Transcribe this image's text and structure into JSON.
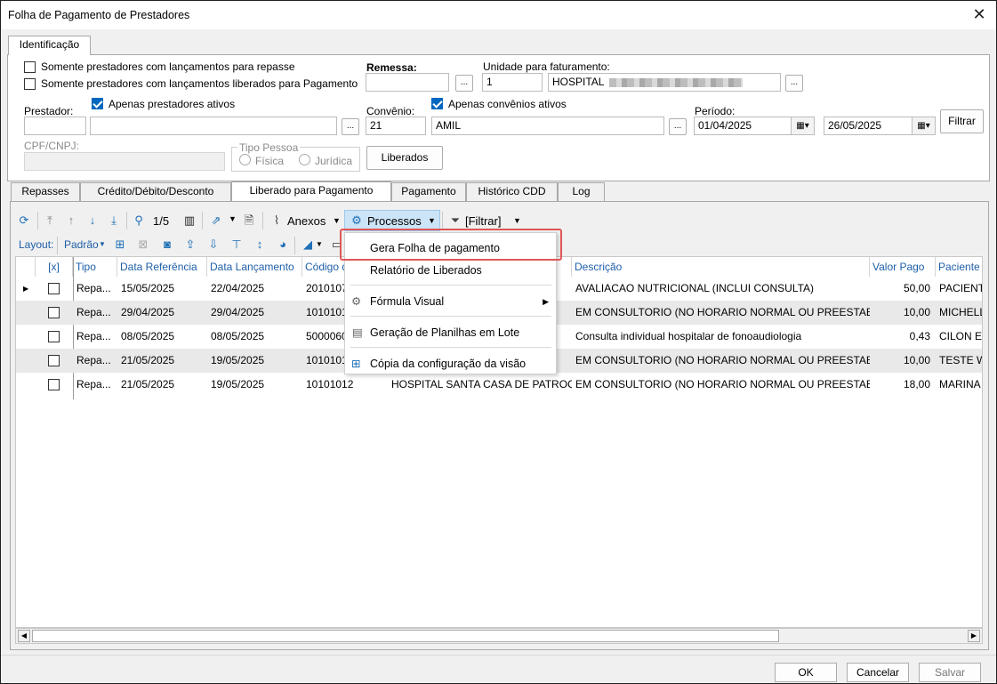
{
  "window": {
    "title": "Folha de Pagamento de Prestadores"
  },
  "top_tab": {
    "label": "Identificação"
  },
  "filters": {
    "chk_repasse": "Somente prestadores com lançamentos para repasse",
    "chk_liberados": "Somente prestadores com lançamentos liberados para Pagamento",
    "remessa_label": "Remessa:",
    "unidade_label": "Unidade para faturamento:",
    "unidade_code": "1",
    "unidade_name": "HOSPITAL",
    "prestador_label": "Prestador:",
    "chk_prestadores_ativos": "Apenas prestadores ativos",
    "convenio_label": "Convênio:",
    "convenio_code": "21",
    "convenio_name": "AMIL",
    "chk_convenios_ativos": "Apenas convênios ativos",
    "periodo_label": "Período:",
    "date_from": "01/04/2025",
    "date_to": "26/05/2025",
    "filtrar": "Filtrar",
    "cpf_label": "CPF/CNPJ:",
    "tipo_pessoa_label": "Tipo Pessoa",
    "fisica": "Física",
    "juridica": "Jurídica",
    "liberados_btn": "Liberados",
    "dots": "..."
  },
  "sub_tabs": [
    "Repasses",
    "Crédito/Débito/Desconto",
    "Liberado para Pagamento",
    "Pagamento",
    "Histórico CDD",
    "Log"
  ],
  "toolbar": {
    "page": "1/5",
    "anexos": "Anexos",
    "processos": "Processos",
    "filtrar": "[Filtrar]",
    "layout_label": "Layout:",
    "layout_value": "Padrão"
  },
  "grid": {
    "headers": [
      "[x]",
      "Tipo",
      "Data Referência",
      "Data Lançamento",
      "Código do",
      "",
      "Descrição",
      "Valor Pago",
      "Paciente"
    ],
    "rows": [
      {
        "tipo": "Repa...",
        "ref": "15/05/2025",
        "lanc": "22/04/2025",
        "codigo": "2010107",
        "origem": "",
        "descricao": "AVALIACAO NUTRICIONAL (INCLUI CONSULTA)",
        "valor": "50,00",
        "paciente": "PACIENTE"
      },
      {
        "tipo": "Repa...",
        "ref": "29/04/2025",
        "lanc": "29/04/2025",
        "codigo": "1010101",
        "origem": "",
        "descricao": "EM CONSULTORIO (NO HORARIO NORMAL OU PREESTABELECI...",
        "valor": "10,00",
        "paciente": "MICHELLE"
      },
      {
        "tipo": "Repa...",
        "ref": "08/05/2025",
        "lanc": "08/05/2025",
        "codigo": "5000060",
        "origem": "",
        "descricao": "Consulta individual hospitalar de fonoaudiologia",
        "valor": "0,43",
        "paciente": "CILON ELI"
      },
      {
        "tipo": "Repa...",
        "ref": "21/05/2025",
        "lanc": "19/05/2025",
        "codigo": "1010101",
        "origem": "",
        "descricao": "EM CONSULTORIO (NO HORARIO NORMAL OU PREESTABELECI...",
        "valor": "10,00",
        "paciente": "TESTE WE"
      },
      {
        "tipo": "Repa...",
        "ref": "21/05/2025",
        "lanc": "19/05/2025",
        "codigo": "10101012",
        "origem": "HOSPITAL SANTA CASA DE PATROCI...",
        "descricao": "EM CONSULTORIO (NO HORARIO NORMAL OU PREESTABELECI...",
        "valor": "18,00",
        "paciente": "MARINA F"
      }
    ]
  },
  "menu": {
    "items": [
      "Gera Folha de pagamento",
      "Relatório de Liberados",
      "Fórmula Visual",
      "Geração de Planilhas em Lote",
      "Cópia da configuração da visão"
    ]
  },
  "footer": {
    "ok": "OK",
    "cancelar": "Cancelar",
    "salvar": "Salvar"
  }
}
